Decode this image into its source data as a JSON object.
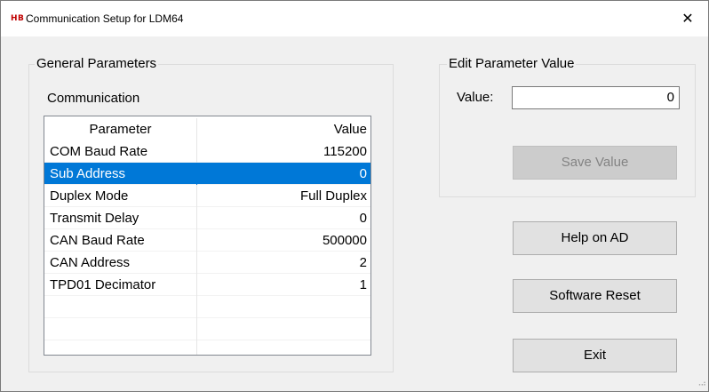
{
  "window": {
    "title": "Communication Setup for LDM64",
    "icon_text": "HB",
    "close_glyph": "✕"
  },
  "general": {
    "legend": "General Parameters",
    "communication_label": "Communication",
    "grid": {
      "headers": [
        "Parameter",
        "Value"
      ],
      "rows": [
        {
          "param": "COM Baud Rate",
          "value": "115200"
        },
        {
          "param": "Sub Address",
          "value": "0"
        },
        {
          "param": "Duplex Mode",
          "value": "Full Duplex"
        },
        {
          "param": "Transmit Delay",
          "value": "0"
        },
        {
          "param": "CAN Baud Rate",
          "value": "500000"
        },
        {
          "param": "CAN Address",
          "value": "2"
        },
        {
          "param": "TPD01 Decimator",
          "value": "1"
        }
      ],
      "selected_row": 1
    }
  },
  "edit": {
    "legend": "Edit Parameter Value",
    "value_label": "Value:",
    "value_input": "0",
    "save_label": "Save Value"
  },
  "buttons": {
    "help_label": "Help on AD",
    "reset_label": "Software Reset",
    "exit_label": "Exit"
  },
  "colors": {
    "selection": "#0078d7",
    "window_bg": "#f0f0f0",
    "icon_red": "#c00000"
  }
}
